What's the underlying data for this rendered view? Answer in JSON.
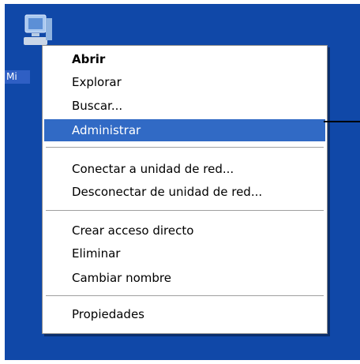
{
  "desktop": {
    "icon_label": "Mi"
  },
  "context_menu": {
    "items": [
      {
        "label": "Abrir"
      },
      {
        "label": "Explorar"
      },
      {
        "label": "Buscar..."
      },
      {
        "label": "Administrar"
      },
      {
        "label": "Conectar a unidad de red..."
      },
      {
        "label": "Desconectar de unidad de red..."
      },
      {
        "label": "Crear acceso directo"
      },
      {
        "label": "Eliminar"
      },
      {
        "label": "Cambiar nombre"
      },
      {
        "label": "Propiedades"
      }
    ],
    "selected_item": "Administrar",
    "default_item": "Abrir"
  },
  "colors": {
    "desktop_background": "#1048a8",
    "menu_background": "#ffffff",
    "selection_highlight": "#316ac5",
    "separator": "#a0a0a0"
  }
}
